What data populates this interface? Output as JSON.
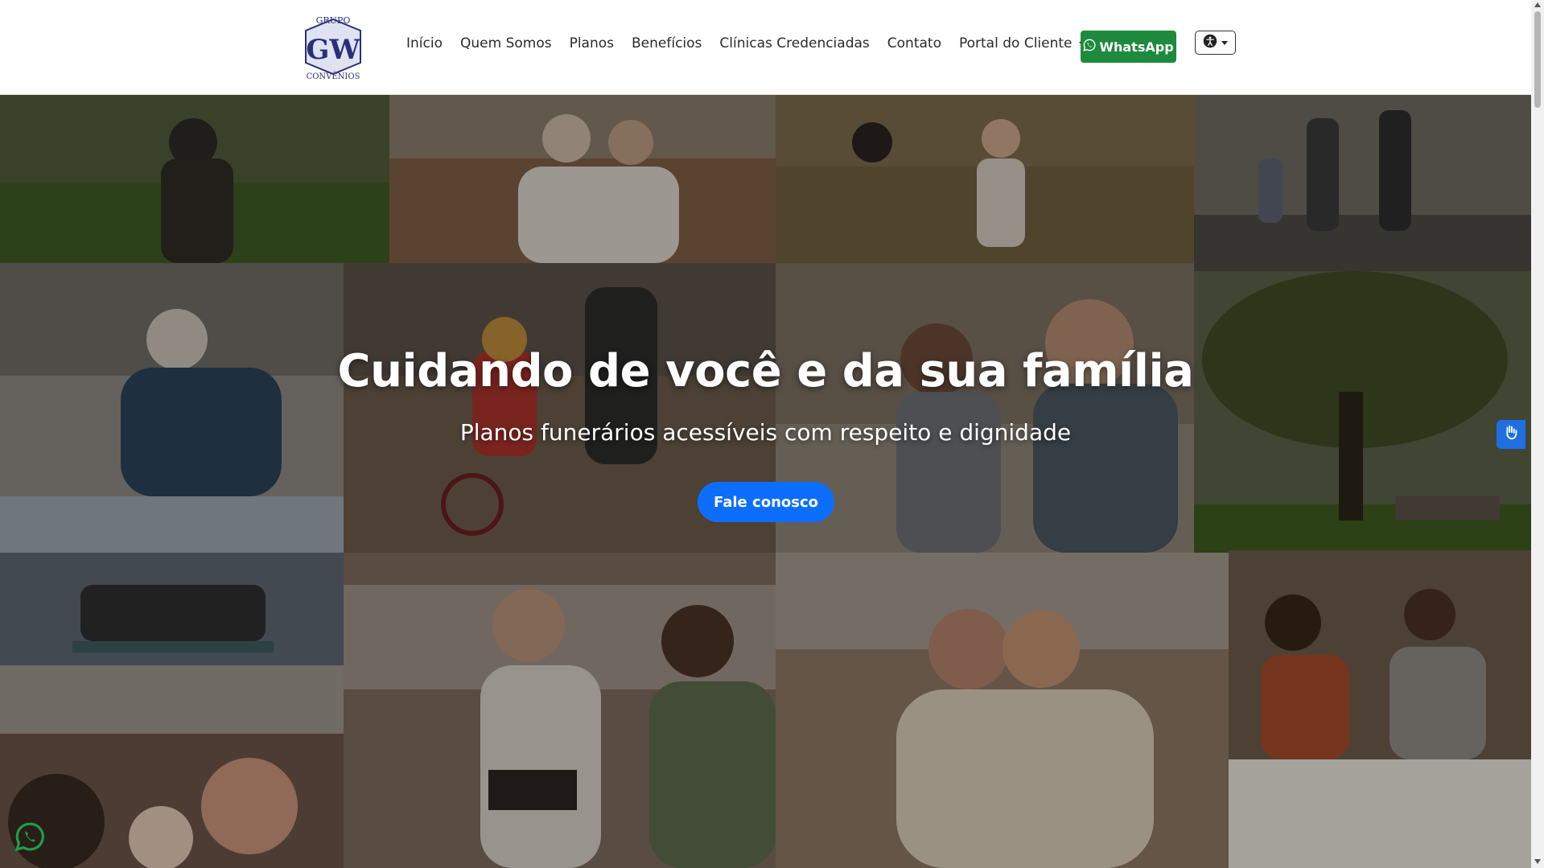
{
  "brand": {
    "logo_top_text": "GRUPO",
    "logo_monogram": "GW",
    "logo_bottom_text": "CONVÊNIOS"
  },
  "nav": {
    "items": [
      {
        "label": "Início"
      },
      {
        "label": "Quem Somos"
      },
      {
        "label": "Planos"
      },
      {
        "label": "Benefícios"
      },
      {
        "label": "Clínicas Credenciadas"
      },
      {
        "label": "Contato"
      },
      {
        "label": "Portal do Cliente"
      }
    ],
    "whatsapp_label": "WhatsApp"
  },
  "hero": {
    "title": "Cuidando de você e da sua família",
    "subtitle": "Planos funerários acessíveis com respeito e dignidade",
    "cta_label": "Fale conosco"
  },
  "photos": [
    {
      "name": "family-walking-field-photo",
      "color": "#4f5b3a"
    },
    {
      "name": "women-hugging-sofa-photo",
      "color": "#8a7a6a"
    },
    {
      "name": "family-playing-field-photo",
      "color": "#7a6a4c"
    },
    {
      "name": "family-dancing-photo",
      "color": "#6e6a62"
    },
    {
      "name": "mother-daughter-sofa-photo",
      "color": "#6f6a63"
    },
    {
      "name": "family-biking-autumn-photo",
      "color": "#6a5a48"
    },
    {
      "name": "grandfather-grandson-photo",
      "color": "#7a6e60"
    },
    {
      "name": "family-tree-picnic-photo",
      "color": "#3f4a26"
    },
    {
      "name": "elders-bench-waterfront-photo",
      "color": "#5d6670"
    },
    {
      "name": "family-reading-bed-photo",
      "color": "#7b6a5e"
    },
    {
      "name": "family-hugging-home-photo",
      "color": "#8b7662"
    },
    {
      "name": "family-dinner-table-photo",
      "color": "#6b5a4a"
    },
    {
      "name": "parents-baby-kiss-photo",
      "color": "#6a5448"
    }
  ],
  "colors": {
    "whatsapp_green": "#1e8a3e",
    "cta_blue": "#0d6efd",
    "brand_navy": "#2a2f7a"
  }
}
